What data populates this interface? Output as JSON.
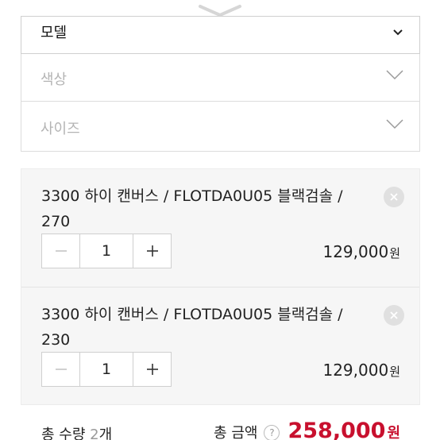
{
  "selects": {
    "option": {
      "label": "모델"
    },
    "color": {
      "placeholder": "색상"
    },
    "size": {
      "placeholder": "사이즈"
    }
  },
  "items": [
    {
      "name": "3300 하이 캔버스 / FLOTDA0U05 블랙검솔 / 270",
      "quantity": "1",
      "price": "129,000",
      "currency": "원"
    },
    {
      "name": "3300 하이 캔버스 / FLOTDA0U05 블랙검솔 / 230",
      "quantity": "1",
      "price": "129,000",
      "currency": "원"
    }
  ],
  "summary": {
    "total_quantity_label": "총 수량 ",
    "total_quantity": "2",
    "total_quantity_unit": "개",
    "total_amount_label": "총 금액",
    "help_icon_text": "?",
    "total_amount": "258,000",
    "currency": "원"
  },
  "colors": {
    "accent": "#c8102e",
    "border": "#dcdcdc",
    "panel": "#f6f6f6"
  },
  "icons": [
    "chevron-down-icon",
    "close-icon",
    "minus-icon",
    "plus-icon",
    "help-icon"
  ]
}
